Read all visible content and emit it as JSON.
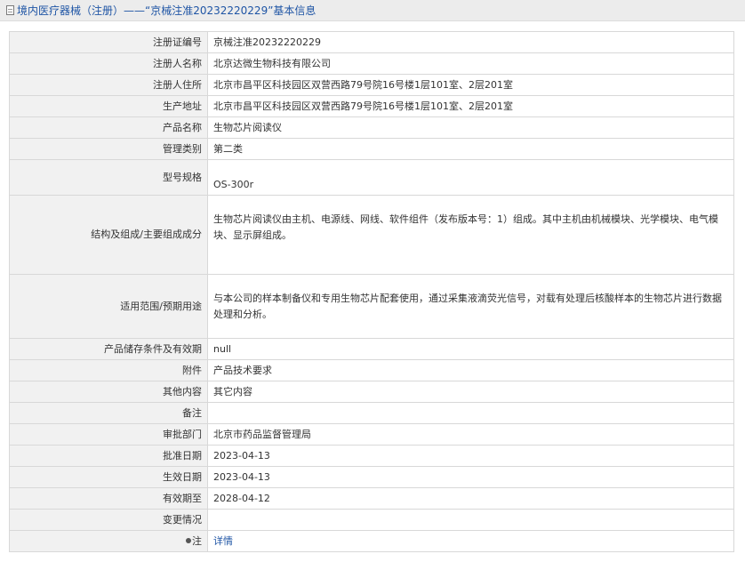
{
  "header": {
    "title": "境内医疗器械（注册）——“京械注准20232220229”基本信息",
    "icon": "document-icon"
  },
  "rows": {
    "reg_no": {
      "label": "注册证编号",
      "value": "京械注准20232220229"
    },
    "registrant": {
      "label": "注册人名称",
      "value": "北京达微生物科技有限公司"
    },
    "address": {
      "label": "注册人住所",
      "value": "北京市昌平区科技园区双营西路79号院16号楼1层101室、2层201室"
    },
    "production": {
      "label": "生产地址",
      "value": "北京市昌平区科技园区双营西路79号院16号楼1层101室、2层201室"
    },
    "product": {
      "label": "产品名称",
      "value": "生物芯片阅读仪"
    },
    "category": {
      "label": "管理类别",
      "value": "第二类"
    },
    "model": {
      "label": "型号规格",
      "value": "OS-300r"
    },
    "structure": {
      "label": "结构及组成/主要组成成分",
      "value": "生物芯片阅读仪由主机、电源线、网线、软件组件（发布版本号：1）组成。其中主机由机械模块、光学模块、电气模块、显示屏组成。"
    },
    "usage": {
      "label": "适用范围/预期用途",
      "value": "与本公司的样本制备仪和专用生物芯片配套使用，通过采集液滴荧光信号，对载有处理后核酸样本的生物芯片进行数据处理和分析。"
    },
    "storage": {
      "label": "产品储存条件及有效期",
      "value": "null"
    },
    "attachment": {
      "label": "附件",
      "value": "产品技术要求"
    },
    "other": {
      "label": "其他内容",
      "value": "其它内容"
    },
    "remark": {
      "label": "备注",
      "value": ""
    },
    "approver": {
      "label": "审批部门",
      "value": "北京市药品监督管理局"
    },
    "approve_date": {
      "label": "批准日期",
      "value": "2023-04-13"
    },
    "effective": {
      "label": "生效日期",
      "value": "2023-04-13"
    },
    "valid_until": {
      "label": "有效期至",
      "value": "2028-04-12"
    },
    "changes": {
      "label": "变更情况",
      "value": ""
    },
    "note": {
      "label": "注",
      "value": "详情",
      "icon": "pin-icon"
    }
  },
  "colors": {
    "link": "#1f55a5",
    "label_bg": "#f1f1f1",
    "border": "#d8d8d8",
    "title_bar_bg": "#ececec"
  }
}
